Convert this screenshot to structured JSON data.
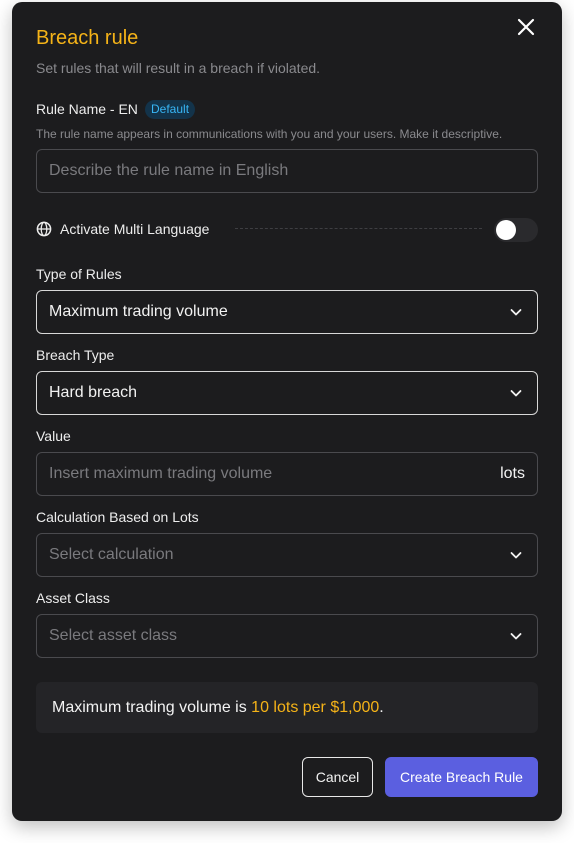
{
  "dialog": {
    "title": "Breach rule",
    "subtitle": "Set rules that will result in a breach if violated."
  },
  "rule_name": {
    "label": "Rule Name - EN",
    "badge": "Default",
    "hint": "The rule name appears in communications with you and your users. Make it descriptive.",
    "placeholder": "Describe the rule name in English",
    "value": ""
  },
  "multi_language": {
    "label": "Activate Multi Language",
    "enabled": false
  },
  "type_of_rules": {
    "label": "Type of Rules",
    "selected": "Maximum trading volume"
  },
  "breach_type": {
    "label": "Breach Type",
    "selected": "Hard breach"
  },
  "value_field": {
    "label": "Value",
    "placeholder": "Insert maximum trading volume",
    "suffix": "lots"
  },
  "calculation": {
    "label": "Calculation Based on Lots",
    "placeholder": "Select calculation"
  },
  "asset_class": {
    "label": "Asset Class",
    "placeholder": "Select asset class"
  },
  "summary": {
    "prefix": "Maximum trading volume is ",
    "highlight": "10 lots per $1,000",
    "suffix": "."
  },
  "buttons": {
    "cancel": "Cancel",
    "create": "Create Breach Rule"
  },
  "colors": {
    "accent": "#f5b318",
    "primary_button": "#5b5fe0",
    "badge_text": "#38b6f5",
    "background": "#1c1c1e"
  },
  "icons": [
    "close-icon",
    "globe-icon",
    "chevron-down-icon"
  ]
}
